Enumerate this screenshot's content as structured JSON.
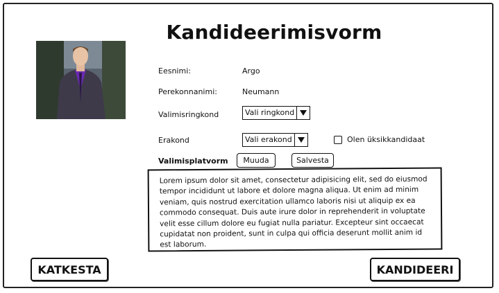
{
  "form": {
    "title": "Kandideerimisvorm",
    "first_name_label": "Eesnimi:",
    "first_name_value": "Argo",
    "last_name_label": "Perekonnanimi:",
    "last_name_value": "Neumann",
    "district_label": "Valimisringkond",
    "district_select": "Vali ringkond",
    "party_label": "Erakond",
    "party_select": "Vali erakond",
    "independent_label": "Olen üksikkandidaat",
    "platform_label": "Valimisplatvorm",
    "edit_button": "Muuda",
    "save_button": "Salvesta",
    "platform_text": "Lorem ipsum dolor sit amet, consectetur adipisicing elit, sed do eiusmod tempor incididunt ut labore et dolore magna aliqua. Ut enim ad minim veniam, quis nostrud exercitation ullamco laboris nisi ut aliquip ex ea commodo consequat. Duis aute irure dolor in reprehenderit in voluptate velit esse cillum dolore eu fugiat nulla pariatur. Excepteur sint occaecat cupidatat non proident, sunt in culpa qui officia deserunt mollit anim id est laborum.",
    "cancel_button": "KATKESTA",
    "apply_button": "KANDIDEERI"
  },
  "icons": {
    "dropdown": "triangle-down-icon",
    "photo": "candidate-photo"
  },
  "colors": {
    "border": "#111111",
    "background": "#ffffff",
    "suit": "#3f3a4a",
    "shirt": "#6a2bb0"
  }
}
